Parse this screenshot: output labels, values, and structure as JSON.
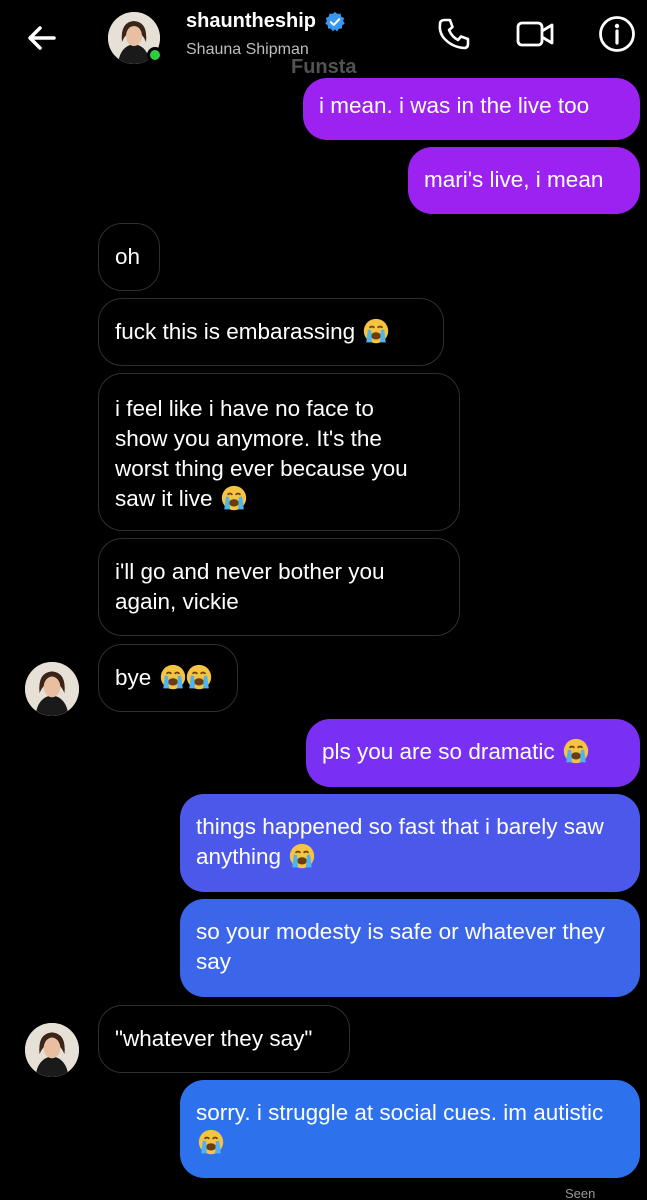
{
  "header": {
    "username": "shauntheship",
    "full_name": "Shauna Shipman",
    "watermark": "Funsta"
  },
  "colors": {
    "purple": "#9b22f0",
    "violet": "#7a30f2",
    "indigo": "#4b58ea",
    "blue_mid": "#3b66ea",
    "blue": "#2d72ec",
    "incoming_border": "#2f2f2f"
  },
  "icons": [
    "back-arrow-icon",
    "verified-badge-icon",
    "phone-icon",
    "video-camera-icon",
    "info-icon",
    "loudly-crying-face-emoji"
  ],
  "messages": {
    "m1": "i mean. i was in the live too",
    "m2": "mari's live, i mean",
    "m3": "oh",
    "m4": "fuck this is embarassing",
    "m5": "i feel like i have no face to show you anymore. It's the worst thing ever because you saw it live",
    "m6": "i'll go and never bother you again, vickie",
    "m7": "bye",
    "m8": "pls you are so dramatic",
    "m9": "things happened so fast that i barely saw anything",
    "m10": "so your modesty is safe or whatever they say",
    "m11": "\"whatever they say\"",
    "m12": "sorry. i struggle at social cues. im autistic"
  },
  "status": {
    "seen": "Seen"
  }
}
